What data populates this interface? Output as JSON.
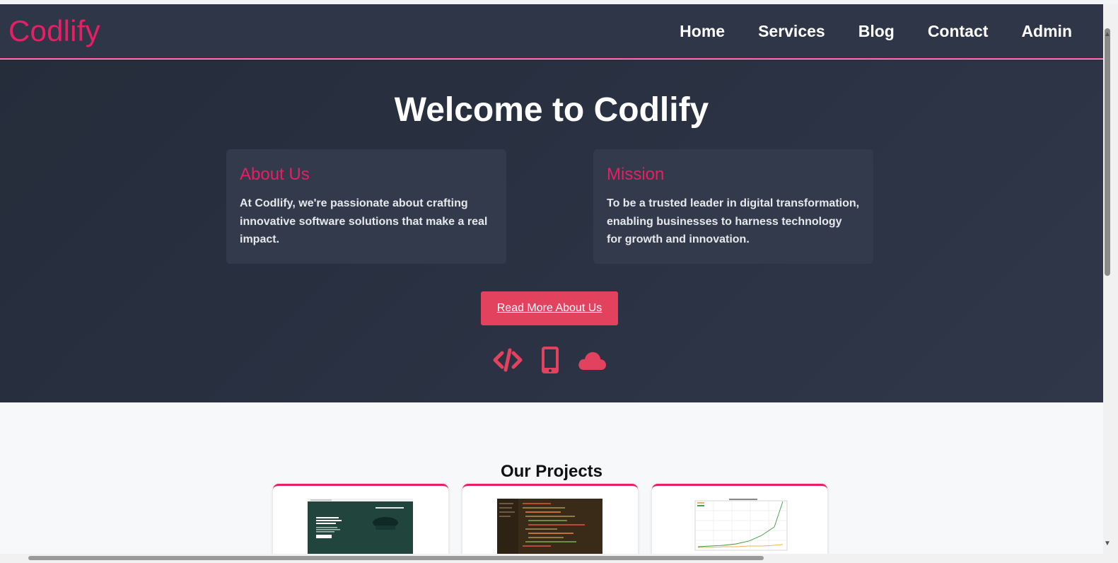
{
  "nav": {
    "brand": "Codlify",
    "links": [
      "Home",
      "Services",
      "Blog",
      "Contact",
      "Admin"
    ]
  },
  "hero": {
    "title": "Welcome to Codlify",
    "cards": [
      {
        "title": "About Us",
        "text": "At Codlify, we're passionate about crafting innovative software solutions that make a real impact."
      },
      {
        "title": "Mission",
        "text": "To be a trusted leader in digital transformation, enabling businesses to harness technology for growth and innovation."
      }
    ],
    "cta_label": "Read More About Us",
    "icons": [
      "code-icon",
      "mobile-icon",
      "cloud-icon"
    ]
  },
  "projects": {
    "title": "Our Projects",
    "items": [
      {
        "thumbnail": "website-screenshot"
      },
      {
        "thumbnail": "code-editor-screenshot"
      },
      {
        "thumbnail": "line-chart-screenshot"
      }
    ]
  },
  "colors": {
    "accent": "#e91e63",
    "button": "#e3425f",
    "navbar": "#2e3648",
    "hero": "#2a3243"
  }
}
